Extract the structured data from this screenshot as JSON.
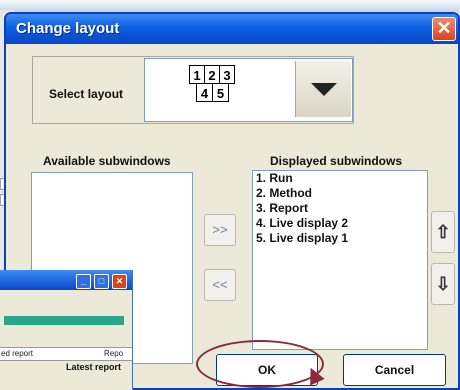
{
  "dialog": {
    "title": "Change layout",
    "close_symbol": "✕"
  },
  "layout": {
    "label": "Select layout",
    "grid_top": [
      "1",
      "2",
      "3"
    ],
    "grid_bottom": [
      "4",
      "5"
    ]
  },
  "available": {
    "label": "Available subwindows",
    "items": []
  },
  "displayed": {
    "label": "Displayed subwindows",
    "items": [
      "1. Run",
      "2. Method",
      "3. Report",
      "4. Live display 2",
      "5. Live display 1"
    ]
  },
  "move_buttons": {
    "add": ">>",
    "remove": "<<",
    "up": "⇧",
    "down": "⇩"
  },
  "buttons": {
    "ok": "OK",
    "cancel": "Cancel"
  },
  "background_window": {
    "col1": "ed report",
    "col2": "Repo",
    "latest": "Latest report"
  },
  "colors": {
    "titlebar": "#0b5ee0",
    "highlight": "#8a2a3a",
    "progress": "#2aa688"
  }
}
